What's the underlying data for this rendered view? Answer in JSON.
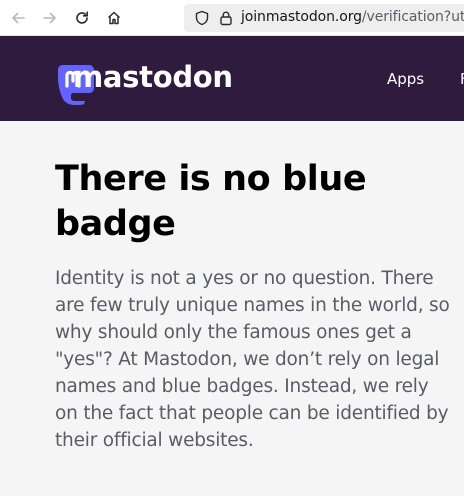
{
  "browser": {
    "back_icon": "arrow-left-icon",
    "forward_icon": "arrow-right-icon",
    "reload_icon": "reload-icon",
    "home_icon": "home-icon",
    "security_icon": "shield-icon",
    "lock_icon": "lock-icon",
    "url_host": "joinmastodon.org",
    "url_path": "/verification?utm_"
  },
  "header": {
    "logo_icon": "mastodon-logo-icon",
    "logo_text": "mastodon",
    "nav": [
      {
        "label": "Apps"
      },
      {
        "label": "F"
      }
    ],
    "background_color": "#2f1b3d",
    "logo_color": "#6364ff"
  },
  "main": {
    "heading": "There is no blue badge",
    "body": "Identity is not a yes or no question. There are few truly unique names in the world, so why should only the famous ones get a \"yes\"? At Mastodon, we don’t rely on legal names and blue badges. Instead, we rely on the fact that people can be identified by their official websites."
  }
}
